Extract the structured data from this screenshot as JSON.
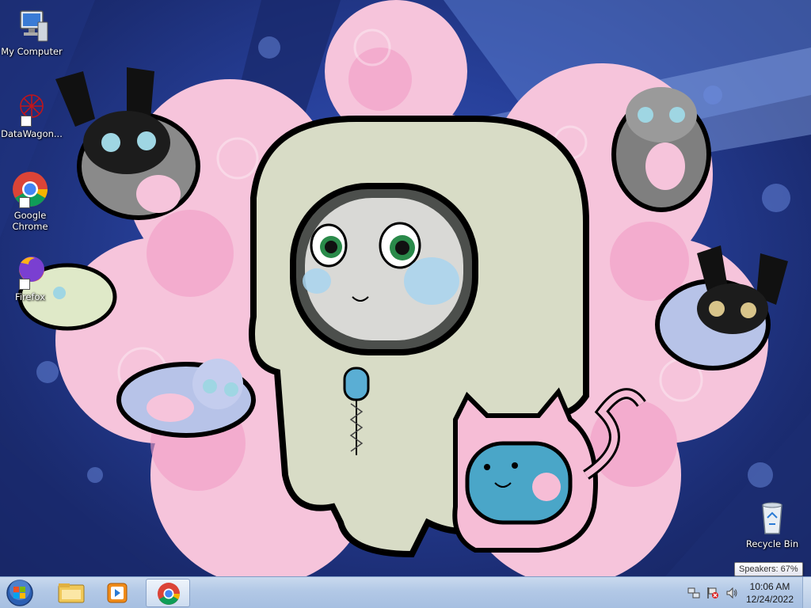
{
  "desktop": {
    "icons": [
      {
        "label": "My Computer",
        "icon": "computer-icon"
      },
      {
        "label": "DataWagon...",
        "icon": "datawagon-icon"
      },
      {
        "label": "Google Chrome",
        "icon": "chrome-icon"
      },
      {
        "label": "Firefox",
        "icon": "firefox-icon"
      },
      {
        "label": "Recycle Bin",
        "icon": "recycle-bin-icon"
      }
    ]
  },
  "taskbar": {
    "start": "start-orb-icon",
    "pinned": [
      {
        "icon": "file-explorer-icon"
      },
      {
        "icon": "media-player-icon"
      },
      {
        "icon": "chrome-icon",
        "active": true
      }
    ],
    "tray": {
      "icons": [
        "network-icon",
        "action-center-icon",
        "speaker-icon"
      ],
      "time": "10:06 AM",
      "date": "12/24/2022"
    }
  },
  "tooltip": {
    "text": "Speakers: 67%"
  },
  "colors": {
    "taskbar": "#b2c8e6",
    "wallpaper_blue": "#27409a",
    "bubble_pink": "#f4b6d2"
  }
}
